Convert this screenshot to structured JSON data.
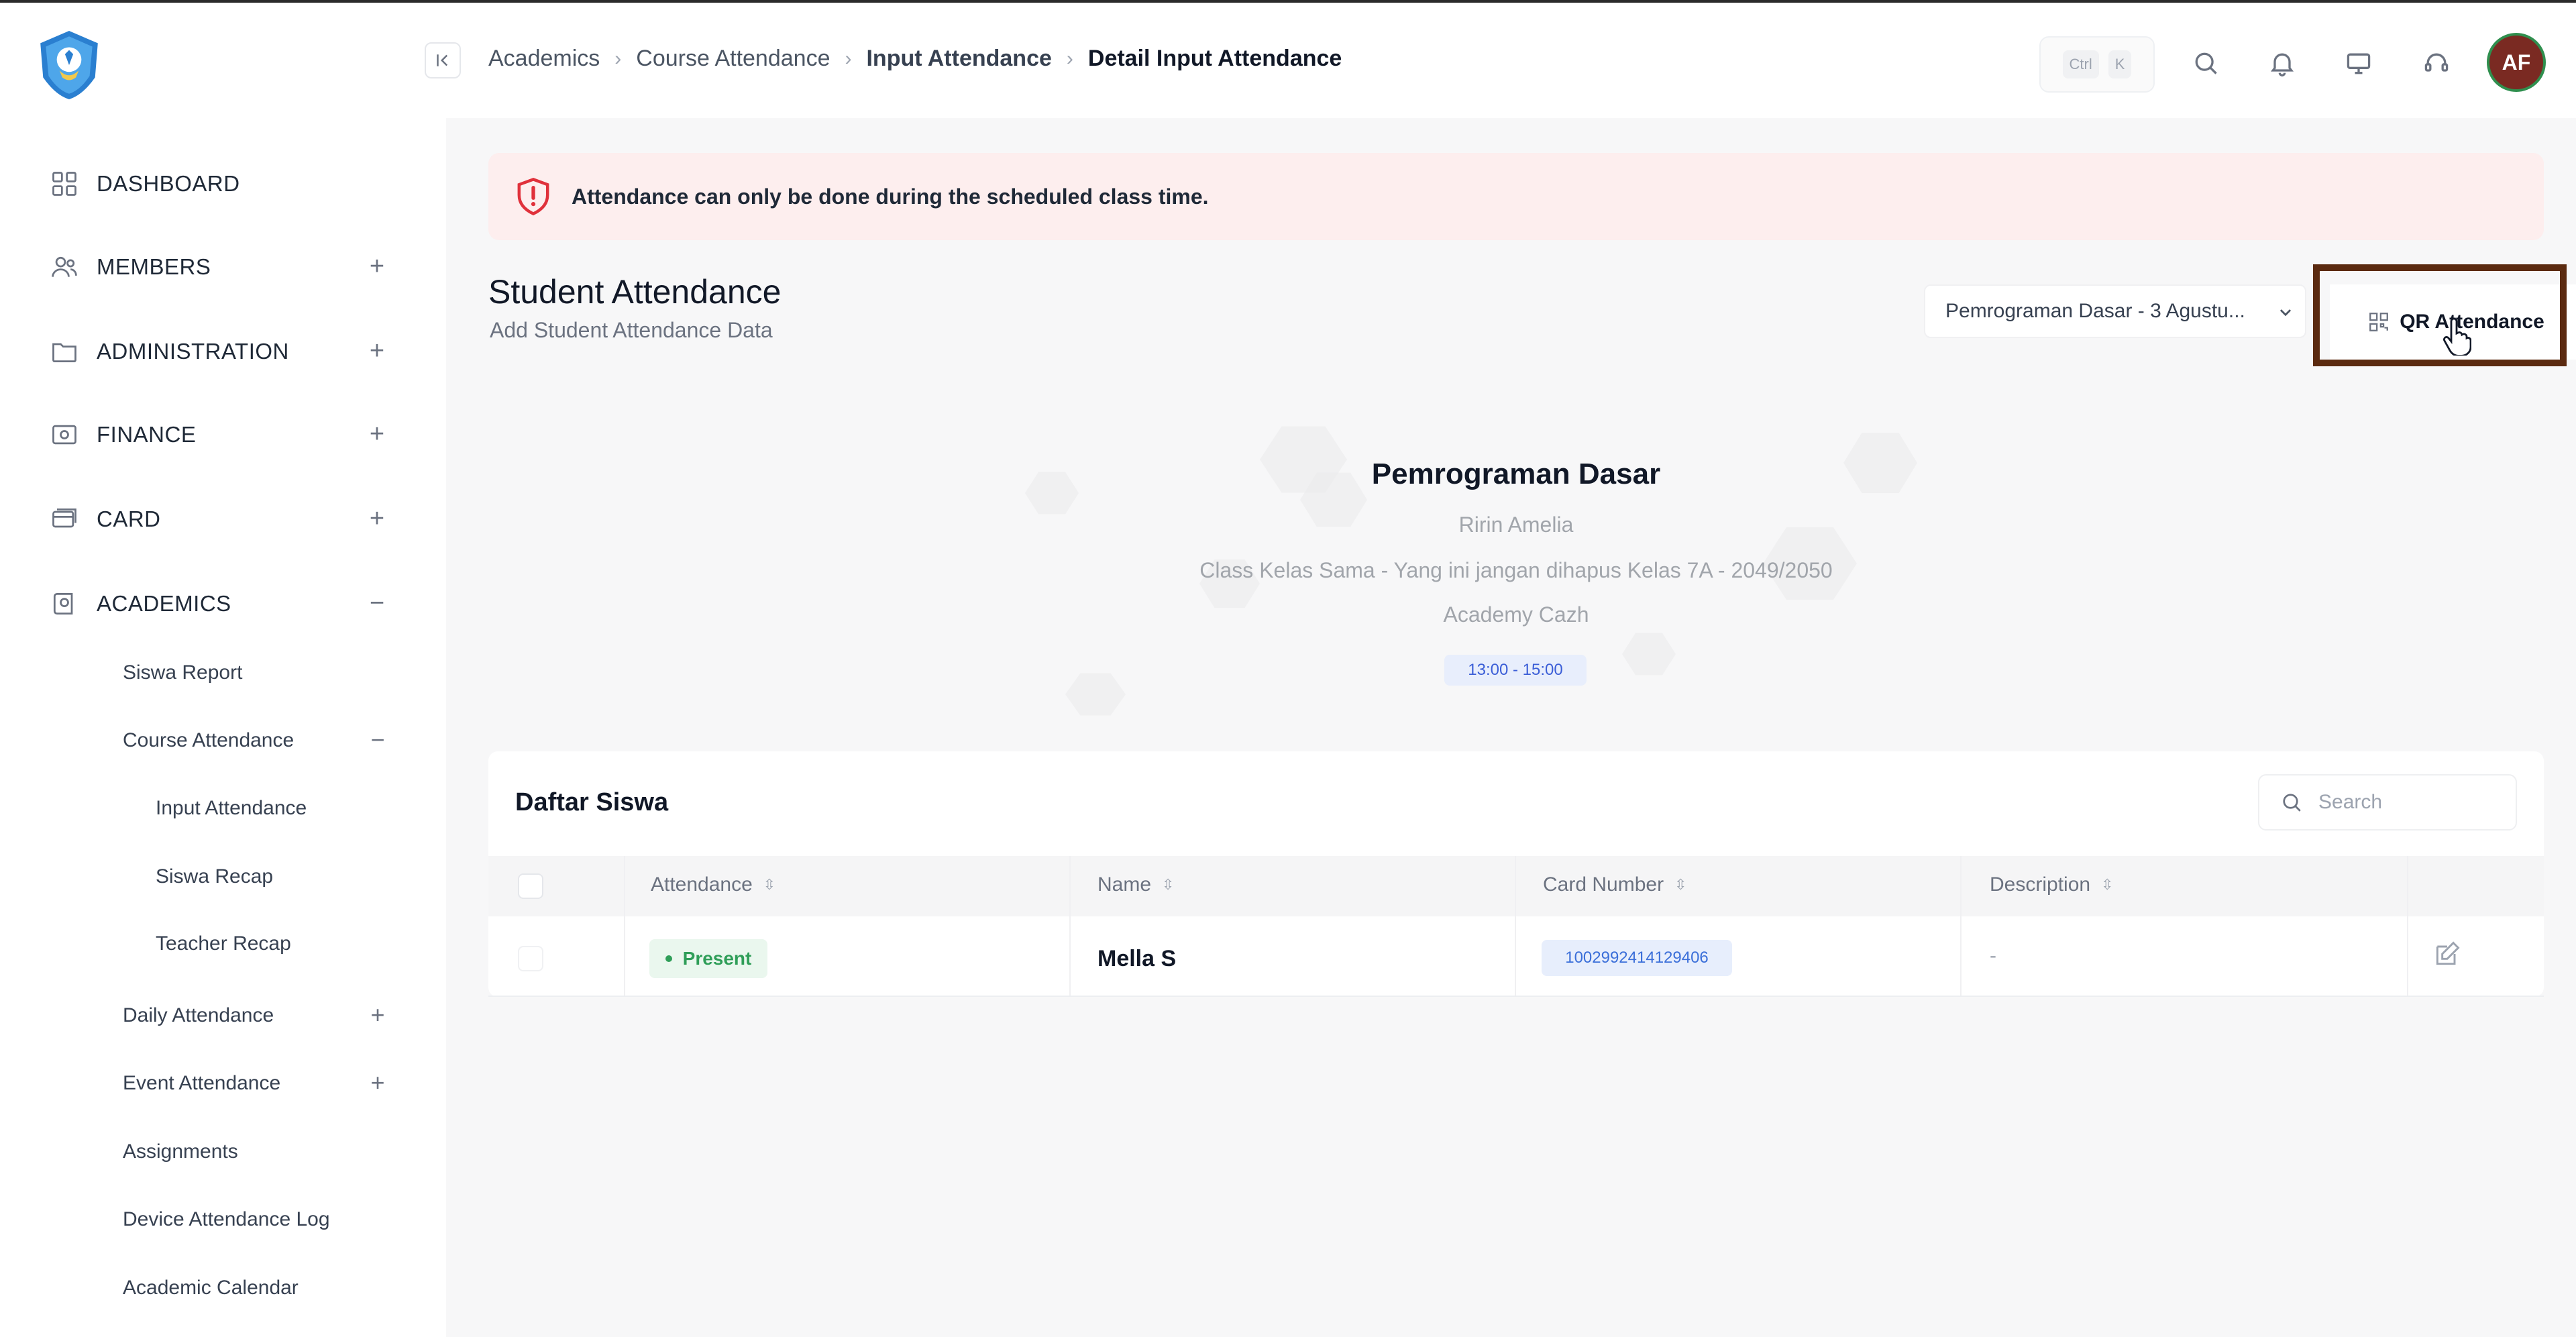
{
  "breadcrumb": [
    "Academics",
    "Course Attendance",
    "Input Attendance",
    "Detail Input Attendance"
  ],
  "shortcut": {
    "key1": "Ctrl",
    "key2": "K"
  },
  "avatar_initials": "AF",
  "sidebar": {
    "main_items": [
      {
        "label": "DASHBOARD",
        "toggle": "",
        "icon": "dashboard-icon"
      },
      {
        "label": "MEMBERS",
        "toggle": "+",
        "icon": "members-icon"
      },
      {
        "label": "ADMINISTRATION",
        "toggle": "+",
        "icon": "folder-icon"
      },
      {
        "label": "FINANCE",
        "toggle": "+",
        "icon": "money-icon"
      },
      {
        "label": "CARD",
        "toggle": "+",
        "icon": "card-icon"
      },
      {
        "label": "ACADEMICS",
        "toggle": "−",
        "icon": "academics-icon"
      }
    ],
    "academics_items": [
      {
        "label": "Siswa Report",
        "toggle": ""
      },
      {
        "label": "Course Attendance",
        "toggle": "−"
      },
      {
        "label": "Input Attendance",
        "toggle": ""
      },
      {
        "label": "Siswa Recap",
        "toggle": ""
      },
      {
        "label": "Teacher Recap",
        "toggle": ""
      },
      {
        "label": "Daily Attendance",
        "toggle": "+"
      },
      {
        "label": "Event Attendance",
        "toggle": "+"
      },
      {
        "label": "Assignments",
        "toggle": ""
      },
      {
        "label": "Device Attendance Log",
        "toggle": ""
      },
      {
        "label": "Academic Calendar",
        "toggle": ""
      }
    ]
  },
  "alert": {
    "text": "Attendance can only be done during the scheduled class time.",
    "color": "#e0313b"
  },
  "page": {
    "title": "Student Attendance",
    "subtitle": "Add Student Attendance Data",
    "course_select": "Pemrograman Dasar - 3 Agustu...",
    "qr_button": "QR Attendance"
  },
  "course": {
    "name": "Pemrograman Dasar",
    "teacher": "Ririn Amelia",
    "class": "Class Kelas Sama - Yang ini jangan dihapus Kelas 7A - 2049/2050",
    "academy": "Academy Cazh",
    "time": "13:00 - 15:00"
  },
  "table": {
    "title": "Daftar Siswa",
    "search_placeholder": "Search",
    "columns": [
      "Attendance",
      "Name",
      "Card Number",
      "Description"
    ],
    "rows": [
      {
        "attendance": "Present",
        "name": "Mella S",
        "card_number": "1002992414129406",
        "description": "-"
      }
    ]
  },
  "colors": {
    "accent_highlight": "#5b2a10",
    "present_green": "#2f9e58",
    "card_blue": "#3b6fd9",
    "avatar_bg": "#7a2a22"
  }
}
